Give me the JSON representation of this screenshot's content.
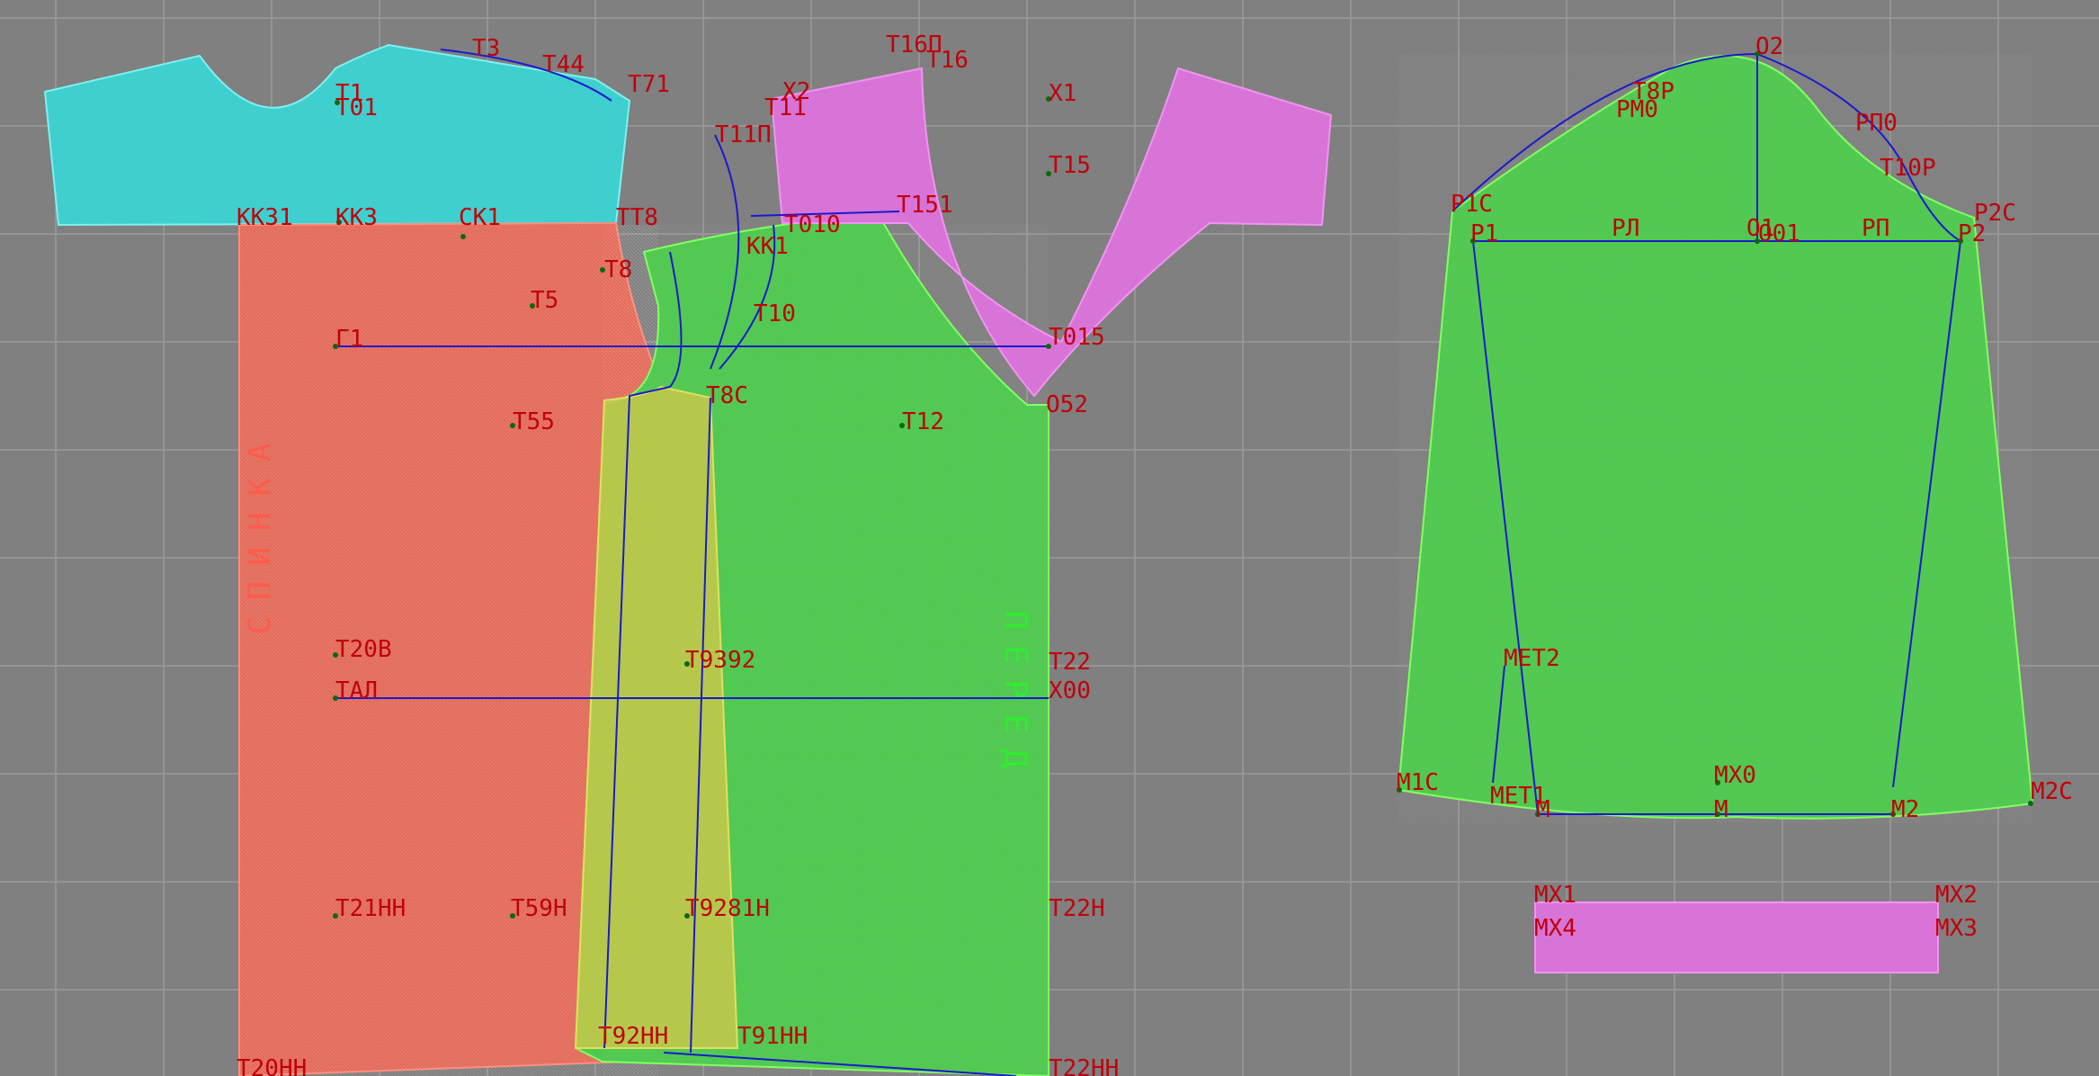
{
  "colors": {
    "background": "#808080",
    "grid": "#9a9a9a",
    "label": "#c0000a",
    "construction_line": "#1a1acc",
    "piece_cyan": "#3fcfcf",
    "piece_red": "#e36b5a",
    "piece_green": "#4fc84f",
    "piece_yellow": "#c8c84a",
    "piece_magenta": "#d873d8"
  },
  "labels": {
    "t3": "T3",
    "t44": "T44",
    "t71": "T71",
    "t1": "T1",
    "t01": "T01",
    "t16p": "T16П",
    "t16": "T16",
    "x2": "X2",
    "x1": "X1",
    "t11": "T11",
    "t11p": "T11П",
    "t15": "T15",
    "kk31": "KK31",
    "kk3": "KK3",
    "sk1": "CK1",
    "tt8": "TT8",
    "t151": "T151",
    "t010": "T010",
    "kk1": "KK1",
    "t8": "T8",
    "t5": "T5",
    "t10": "T10",
    "g1": "Г1",
    "t015": "T015",
    "t8c": "T8C",
    "o52": "O52",
    "t55": "T55",
    "t12": "T12",
    "t20v": "T20B",
    "t9392": "T9392",
    "t22": "T22",
    "tal": "TAЛ",
    "x00": "X00",
    "t21n": "T21HH",
    "t59": "T59H",
    "t9281n": "T9281H",
    "t22n": "T22H",
    "t92nn": "T92HH",
    "t91nn": "T91HH",
    "t20nn": "T20HH",
    "t22nn": "T22HH",
    "o2": "O2",
    "t8r": "T8P",
    "rm0": "PM0",
    "rp0": "PП0",
    "t10r": "T10P",
    "r1c": "P1C",
    "r1": "P1",
    "rl": "PЛ",
    "o1": "O1",
    "o01": "O01",
    "rp": "PП",
    "r2c": "P2C",
    "r2": "P2",
    "met2": "MET2",
    "mx0": "MX0",
    "m1c": "M1C",
    "met1": "MET1",
    "m_left": "M",
    "m_mid": "M",
    "m2": "M2",
    "m2c": "M2C",
    "mx1": "MX1",
    "mx2": "MX2",
    "mx4": "MX4",
    "mx3": "MX3"
  },
  "vertical_texts": {
    "back_piece": "СПИНКА",
    "front_piece": "ПЕРЕД"
  }
}
